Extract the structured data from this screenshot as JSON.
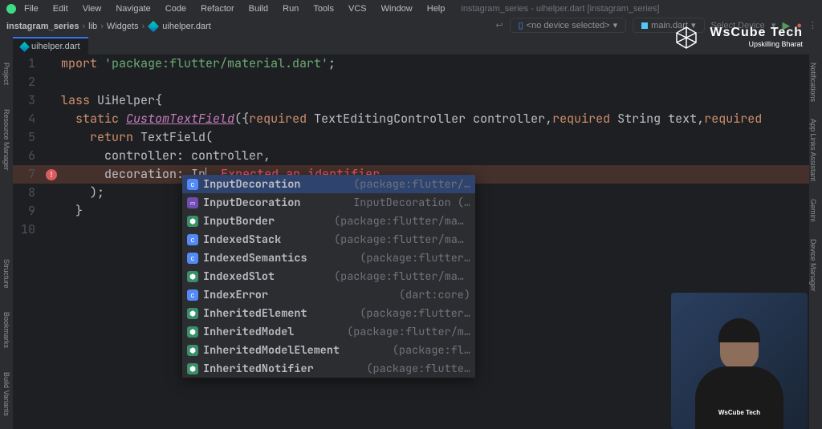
{
  "menu": {
    "items": [
      "File",
      "Edit",
      "View",
      "Navigate",
      "Code",
      "Refactor",
      "Build",
      "Run",
      "Tools",
      "VCS",
      "Window",
      "Help"
    ],
    "projectTitle": "instagram_series - uihelper.dart [instagram_series]"
  },
  "breadcrumbs": {
    "project": "instagram_series",
    "p1": "lib",
    "p2": "Widgets",
    "file": "uihelper.dart"
  },
  "toolbar": {
    "device": "<no device selected>",
    "config": "main.dart",
    "selectDevice": "Select Device"
  },
  "tab": {
    "name": "uihelper.dart"
  },
  "logo": {
    "brand": "WsCube Tech",
    "tagline": "Upskilling Bharat"
  },
  "editor": {
    "lines": [
      {
        "n": 1
      },
      {
        "n": 2
      },
      {
        "n": 3
      },
      {
        "n": 4
      },
      {
        "n": 5
      },
      {
        "n": 6
      },
      {
        "n": 7
      },
      {
        "n": 8
      },
      {
        "n": 9
      },
      {
        "n": 10
      }
    ],
    "tokens": {
      "mport": "mport ",
      "pkg": "'package:flutter/material.dart'",
      "semi": ";",
      "lass": "lass ",
      "clsName": "UiHelper",
      "brace": "{",
      "static": "static ",
      "fn": "CustomTextField",
      "paren": "(",
      "brace2": "{",
      "req": "required",
      "t1": " TextEditingController ",
      "p1": "controller",
      "comma": ",",
      "t2": " String ",
      "p2": "text",
      "return": "return ",
      "tf": "TextField",
      "ctrl": "controller",
      "colon": ": ",
      "ctrlv": "controller",
      "deco": "decoration",
      "typed": "In",
      "err": "Expected an identifier.",
      "closeParen": ");",
      "closeBrace": "}"
    }
  },
  "autocomplete": {
    "items": [
      {
        "icon": "cls-i",
        "name": "InputDecoration",
        "hint": "(package:flutter/…",
        "sel": true
      },
      {
        "icon": "folder",
        "name": "InputDecoration",
        "hint": "InputDecoration (…"
      },
      {
        "icon": "atom",
        "name": "InputBorder",
        "hint": "(package:flutter/mate…"
      },
      {
        "icon": "cls-i",
        "name": "IndexedStack",
        "hint": "(package:flutter/mat…"
      },
      {
        "icon": "cls-i",
        "name": "IndexedSemantics",
        "hint": "(package:flutter…"
      },
      {
        "icon": "atom",
        "name": "IndexedSlot",
        "hint": "(package:flutter/mate…"
      },
      {
        "icon": "cls-i",
        "name": "IndexError",
        "hint": "(dart:core)"
      },
      {
        "icon": "atom",
        "name": "InheritedElement",
        "hint": "(package:flutter…"
      },
      {
        "icon": "atom",
        "name": "InheritedModel",
        "hint": "(package:flutter/m…"
      },
      {
        "icon": "atom",
        "name": "InheritedModelElement",
        "hint": "(package:fl…"
      },
      {
        "icon": "atom",
        "name": "InheritedNotifier",
        "hint": "(package:flutte…"
      }
    ]
  },
  "sidebars": {
    "left": [
      "Project",
      "Resource Manager",
      "Structure",
      "Bookmarks",
      "Build Variants"
    ],
    "right": [
      "Notifications",
      "App Links Assistant",
      "Gemini",
      "Device Manager"
    ]
  }
}
